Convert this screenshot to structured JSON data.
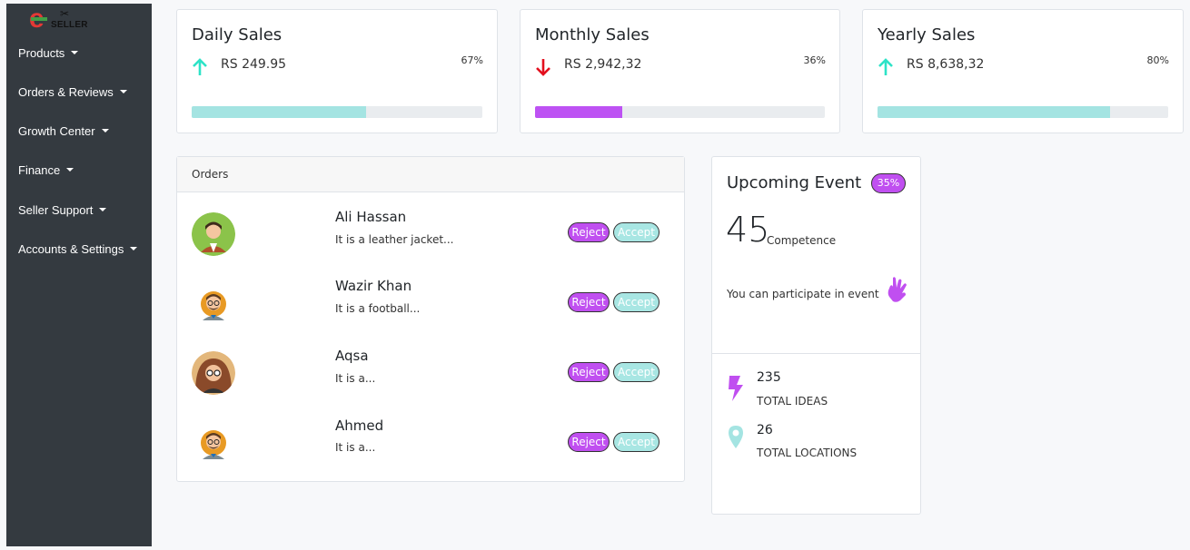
{
  "logo": {
    "letter": "e",
    "text": "SELLER"
  },
  "sidebar": {
    "items": [
      {
        "label": "Products"
      },
      {
        "label": "Orders & Reviews"
      },
      {
        "label": "Growth Center"
      },
      {
        "label": "Finance"
      },
      {
        "label": "Seller Support"
      },
      {
        "label": "Accounts & Settings"
      }
    ]
  },
  "stats": [
    {
      "title": "Daily Sales",
      "value": "RS 249.95",
      "percent_label": "67%",
      "trend": "up",
      "progress": 0.6,
      "arrow_color": "#2de3c7",
      "bar_color": "#a4e4e2"
    },
    {
      "title": "Monthly Sales",
      "value": "RS 2,942,32",
      "percent_label": "36%",
      "trend": "down",
      "progress": 0.3,
      "arrow_color": "#e3101e",
      "bar_color": "#bd52f3"
    },
    {
      "title": "Yearly Sales",
      "value": "RS 8,638,32",
      "percent_label": "80%",
      "trend": "up",
      "progress": 0.8,
      "arrow_color": "#2de3c7",
      "bar_color": "#a4e4e2"
    }
  ],
  "orders": {
    "title": "Orders",
    "reject_label": "Reject",
    "accept_label": "Accept",
    "items": [
      {
        "name": "Ali Hassan",
        "desc": "It is a leather jacket..."
      },
      {
        "name": "Wazir Khan",
        "desc": "It is a football..."
      },
      {
        "name": "Aqsa",
        "desc": "It is a..."
      },
      {
        "name": "Ahmed",
        "desc": "It is a..."
      }
    ]
  },
  "event": {
    "title": "Upcoming Event",
    "badge": "35%",
    "count": "45",
    "count_label": "Competence",
    "desc": "You can participate in event",
    "ideas_count": "235",
    "ideas_label": "TOTAL IDEAS",
    "locations_count": "26",
    "locations_label": "TOTAL LOCATIONS"
  },
  "colors": {
    "accent_purple": "#c04ff0",
    "accent_teal": "#a8e6e3",
    "sidebar_bg": "#343a40"
  }
}
